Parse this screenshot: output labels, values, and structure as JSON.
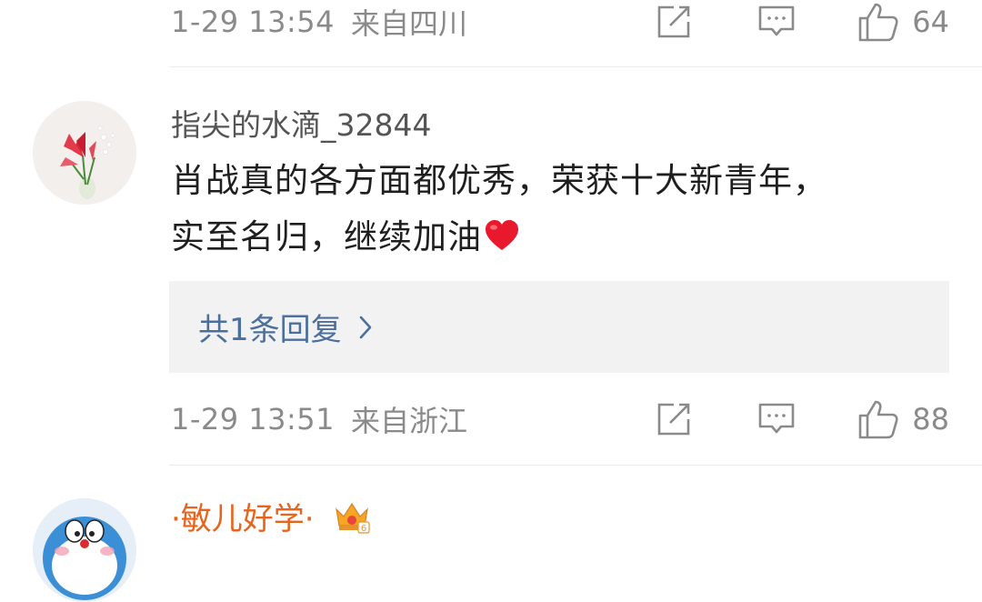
{
  "comments": [
    {
      "time": "1-29 13:54",
      "location": "来自四川",
      "likes": "64"
    },
    {
      "username": "指尖的水滴_32844",
      "text_line1": "肖战真的各方面都优秀，荣获十大新青年，",
      "text_line2": "实至名归，继续加油",
      "emoji": "heart-icon",
      "reply_link": "共1条回复",
      "time": "1-29 13:51",
      "location": "来自浙江",
      "likes": "88"
    },
    {
      "username": "·敏儿好学·",
      "badge": "crown-badge-icon"
    }
  ],
  "colors": {
    "meta_gray": "#8a8a8a",
    "reply_link": "#4d6f9c",
    "vip_name": "#e8631c",
    "reply_bg": "#f2f2f2"
  }
}
